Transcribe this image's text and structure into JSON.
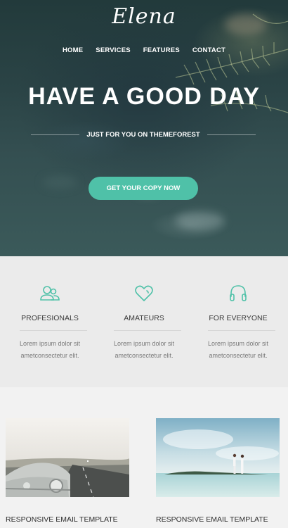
{
  "brand": {
    "logo_text": "Elena",
    "accent_color": "#4fc1a8"
  },
  "nav": {
    "items": [
      {
        "label": "HOME"
      },
      {
        "label": "SERVICES"
      },
      {
        "label": "FEATURES"
      },
      {
        "label": "CONTACT"
      }
    ]
  },
  "hero": {
    "headline": "HAVE A GOOD DAY",
    "tagline": "JUST FOR YOU ON THEMEFOREST",
    "cta_label": "GET YOUR COPY NOW"
  },
  "features": [
    {
      "icon": "users-icon",
      "title": "PROFESIONALS",
      "text": "Lorem ipsum dolor sit ametconsectetur elit."
    },
    {
      "icon": "heart-icon",
      "title": "AMATEURS",
      "text": "Lorem ipsum dolor sit ametconsectetur elit."
    },
    {
      "icon": "headphones-icon",
      "title": "FOR EVERYONE",
      "text": "Lorem ipsum dolor sit ametconsectetur elit."
    }
  ],
  "cards": [
    {
      "image": "vintage-car-photo",
      "title": "RESPONSIVE EMAIL TEMPLATE"
    },
    {
      "image": "couple-on-beach-photo",
      "title": "RESPONSIVE EMAIL TEMPLATE"
    }
  ]
}
